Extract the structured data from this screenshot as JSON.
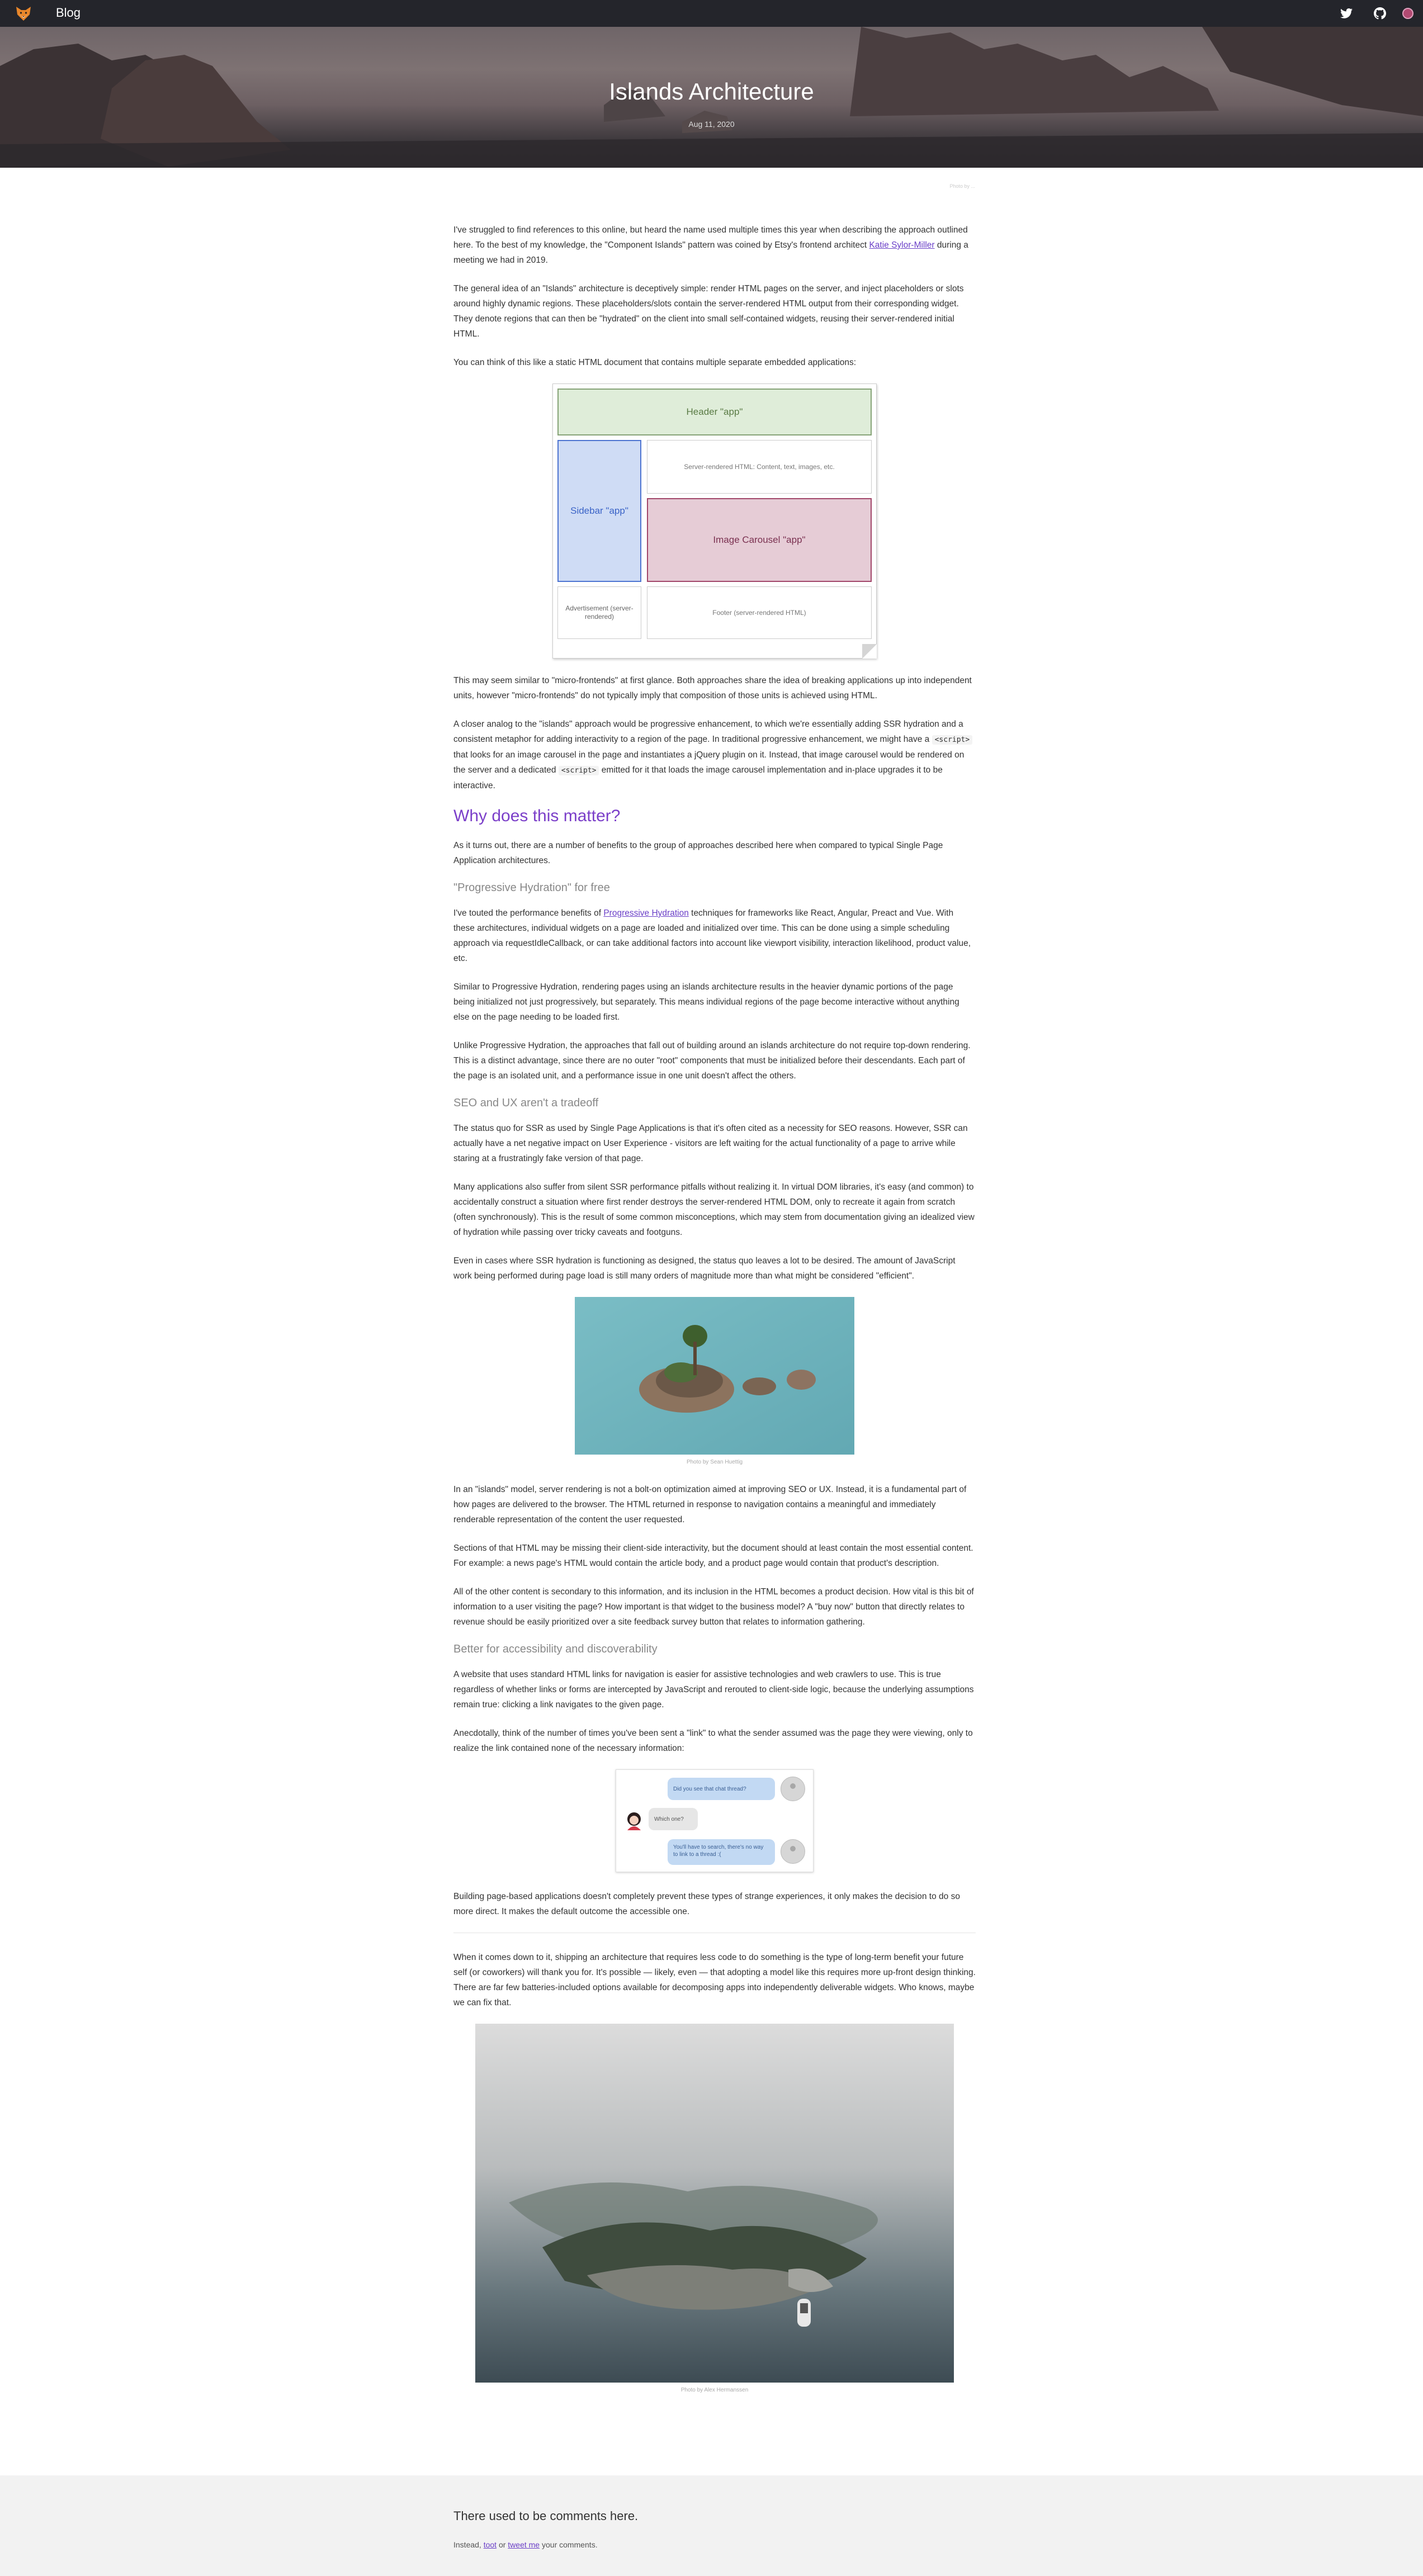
{
  "nav": {
    "blog_label": "Blog",
    "icons": [
      "fox-logo-icon",
      "twitter-icon",
      "github-icon",
      "avatar-icon"
    ]
  },
  "hero": {
    "title": "Islands Architecture",
    "date": "Aug 11, 2020",
    "credit": "Photo by ..."
  },
  "intro": {
    "p1_a": "I've struggled to find references to this online, but heard the name used multiple times this year when describing the approach outlined here. To the best of my knowledge, the \"Component Islands\" pattern was coined by Etsy's frontend architect ",
    "p1_link": "Katie Sylor-Miller",
    "p1_b": " during a meeting we had in 2019.",
    "p2": "The general idea of an \"Islands\" architecture is deceptively simple: render HTML pages on the server, and inject placeholders or slots around highly dynamic regions. These placeholders/slots contain the server-rendered HTML output from their corresponding widget. They denote regions that can then be \"hydrated\" on the client into small self-contained widgets, reusing their server-rendered initial HTML.",
    "p3": "You can think of this like a static HTML document that contains multiple separate embedded applications:"
  },
  "diagram": {
    "header": "Header \"app\"",
    "sidebar": "Sidebar \"app\"",
    "ssr": "Server-rendered HTML: Content, text, images, etc.",
    "carousel": "Image Carousel \"app\"",
    "ad": "Advertisement (server-rendered)",
    "footer": "Footer (server-rendered HTML)"
  },
  "body1": {
    "p4": "This may seem similar to \"micro-frontends\" at first glance. Both approaches share the idea of breaking applications up into independent units, however \"micro-frontends\" do not typically imply that composition of those units is achieved using HTML.",
    "p5_a": "A closer analog to the \"islands\" approach would be progressive enhancement, to which we're essentially adding SSR hydration and a consistent metaphor for adding interactivity to a region of the page. In traditional progressive enhancement, we might have a ",
    "p5_code1": "<script>",
    "p5_b": " that looks for an image carousel in the page and instantiates a jQuery plugin on it. Instead, that image carousel would be rendered on the server and a dedicated ",
    "p5_code2": "<script>",
    "p5_c": " emitted for it that loads the image carousel implementation and in-place upgrades it to be interactive."
  },
  "why": {
    "heading": "Why does this matter?",
    "p1": "As it turns out, there are a number of benefits to the group of approaches described here when compared to typical Single Page Application architectures.",
    "h_hydration": "\"Progressive Hydration\" for free",
    "p2_a": "I've touted the performance benefits of ",
    "p2_link": "Progressive Hydration",
    "p2_b": " techniques for frameworks like React, Angular, Preact and Vue. With these architectures, individual widgets on a page are loaded and initialized over time. This can be done using a simple scheduling approach via requestIdleCallback, or can take additional factors into account like viewport visibility, interaction likelihood, product value, etc.",
    "p3": "Similar to Progressive Hydration, rendering pages using an islands architecture results in the heavier dynamic portions of the page being initialized not just progressively, but separately. This means individual regions of the page become interactive without anything else on the page needing to be loaded first.",
    "p4": "Unlike Progressive Hydration, the approaches that fall out of building around an islands architecture do not require top-down rendering. This is a distinct advantage, since there are no outer \"root\" components that must be initialized before their descendants. Each part of the page is an isolated unit, and a performance issue in one unit doesn't affect the others.",
    "h_seo": "SEO and UX aren't a tradeoff",
    "p5": "The status quo for SSR as used by Single Page Applications is that it's often cited as a necessity for SEO reasons. However, SSR can actually have a net negative impact on User Experience - visitors are left waiting for the actual functionality of a page to arrive while staring at a frustratingly fake version of that page.",
    "p6": "Many applications also suffer from silent SSR performance pitfalls without realizing it. In virtual DOM libraries, it's easy (and common) to accidentally construct a situation where first render destroys the server-rendered HTML DOM, only to recreate it again from scratch (often synchronously). This is the result of some common misconceptions, which may stem from documentation giving an idealized view of hydration while passing over tricky caveats and footguns.",
    "p7": "Even in cases where SSR hydration is functioning as designed, the status quo leaves a lot to be desired. The amount of JavaScript work being performed during page load is still many orders of magnitude more than what might be considered \"efficient\".",
    "img1_caption": "Photo by Sean Huettig",
    "p8": "In an \"islands\" model, server rendering is not a bolt-on optimization aimed at improving SEO or UX. Instead, it is a fundamental part of how pages are delivered to the browser. The HTML returned in response to navigation contains a meaningful and immediately renderable representation of the content the user requested.",
    "p9": "Sections of that HTML may be missing their client-side interactivity, but the document should at least contain the most essential content. For example: a news page's HTML would contain the article body, and a product page would contain that product's description.",
    "p10": "All of the other content is secondary to this information, and its inclusion in the HTML becomes a product decision. How vital is this bit of information to a user visiting the page? How important is that widget to the business model? A \"buy now\" button that directly relates to revenue should be easily prioritized over a site feedback survey button that relates to information gathering.",
    "h_a11y": "Better for accessibility and discoverability",
    "p11": "A website that uses standard HTML links for navigation is easier for assistive technologies and web crawlers to use. This is true regardless of whether links or forms are intercepted by JavaScript and rerouted to client-side logic, because the underlying assumptions remain true: clicking a link navigates to the given page.",
    "p12": "Anecdotally, think of the number of times you've been sent a \"link\" to what the sender assumed was the page they were viewing, only to realize the link contained none of the necessary information:"
  },
  "chat": {
    "msg1": "Did you see that chat thread?",
    "msg2": "Which one?",
    "msg3": "You'll have to search, there's no way to link to a thread :("
  },
  "ending": {
    "p13": "Building page-based applications doesn't completely prevent these types of strange experiences, it only makes the decision to do so more direct. It makes the default outcome the accessible one.",
    "p14": "When it comes down to it, shipping an architecture that requires less code to do something is the type of long-term benefit your future self (or coworkers) will thank you for. It's possible — likely, even — that adopting a model like this requires more up-front design thinking. There are far few batteries-included options available for decomposing apps into independently deliverable widgets. Who knows, maybe we can fix that.",
    "img2_caption": "Photo by Alex Hermanssen"
  },
  "comments": {
    "title": "There used to be comments here.",
    "text_a": "Instead, ",
    "link_toot": "toot",
    "text_b": " or ",
    "link_tweet": "tweet me",
    "text_c": " your comments."
  },
  "colors": {
    "accent": "#6a3fc7",
    "heading_purple": "#7b3fc9",
    "topbar": "#24252b"
  }
}
